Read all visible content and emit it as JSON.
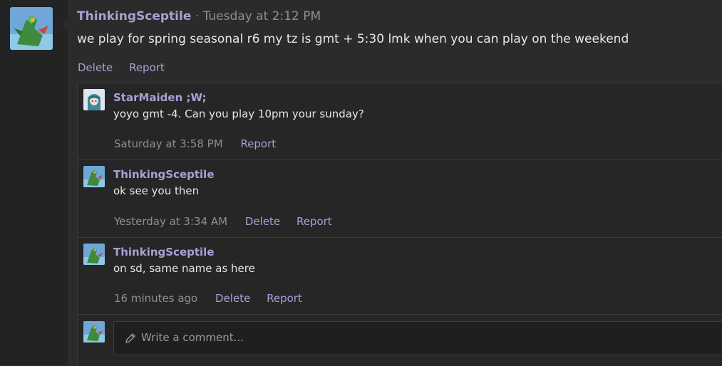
{
  "post": {
    "username": "ThinkingSceptile",
    "separator": "·",
    "timestamp": "Tuesday at 2:12 PM",
    "message": "we play for spring seasonal r6 my tz is gmt + 5:30 lmk when you can play on the weekend",
    "actions": [
      "Delete",
      "Report"
    ]
  },
  "comments": [
    {
      "username": "StarMaiden ;W;",
      "text": "yoyo gmt -4. Can you play 10pm your sunday?",
      "time": "Saturday at 3:58 PM",
      "actions": [
        "Report"
      ]
    },
    {
      "username": "ThinkingSceptile",
      "text": "ok see you then",
      "time": "Yesterday at 3:34 AM",
      "actions": [
        "Delete",
        "Report"
      ]
    },
    {
      "username": "ThinkingSceptile",
      "text": "on sd, same name as here",
      "time": "16 minutes ago",
      "actions": [
        "Delete",
        "Report"
      ]
    }
  ],
  "composer": {
    "placeholder": "Write a comment...",
    "icon": "pencil-icon"
  },
  "colors": {
    "accent": "#a9a1d4",
    "background": "#2b2b2b",
    "muted": "#8f8f8f"
  }
}
